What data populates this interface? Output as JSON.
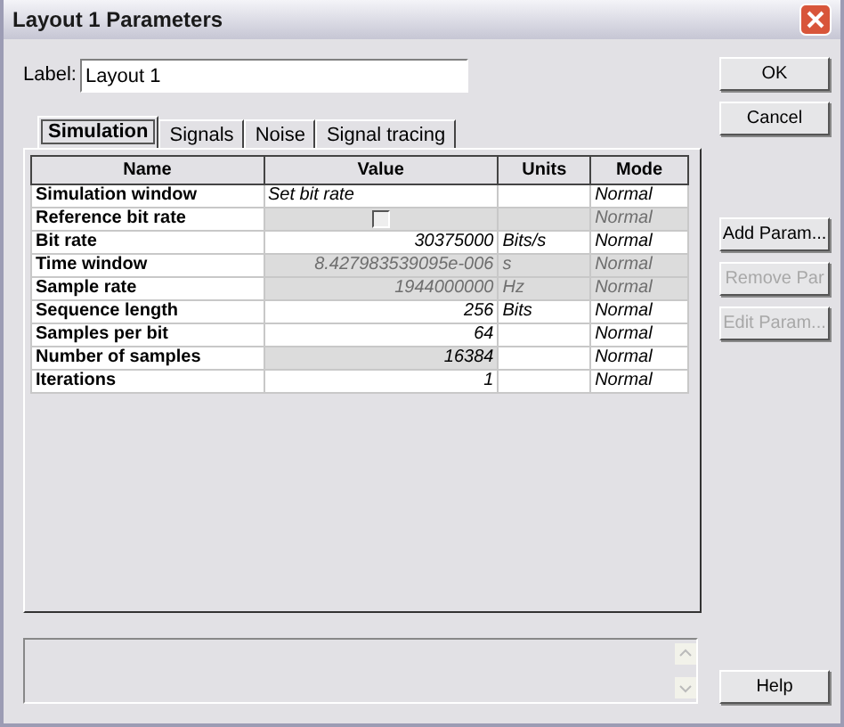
{
  "window": {
    "title": "Layout 1 Parameters"
  },
  "label": {
    "text": "Label:",
    "value": "Layout 1"
  },
  "tabs": [
    {
      "label": "Simulation",
      "selected": true
    },
    {
      "label": "Signals",
      "selected": false
    },
    {
      "label": "Noise",
      "selected": false
    },
    {
      "label": "Signal tracing",
      "selected": false
    }
  ],
  "table": {
    "columns": [
      "Name",
      "Value",
      "Units",
      "Mode"
    ],
    "rows": [
      {
        "name": "Simulation window",
        "kind": "text",
        "value": "Set bit rate",
        "units": "",
        "mode": "Normal",
        "disabled": false,
        "value_shaded": false,
        "units_shaded": false
      },
      {
        "name": "Reference bit rate",
        "kind": "checkbox",
        "checked": false,
        "units": "",
        "mode": "Normal",
        "disabled": true,
        "value_shaded": true,
        "units_shaded": true
      },
      {
        "name": "Bit rate",
        "kind": "number",
        "value": "30375000",
        "units": "Bits/s",
        "mode": "Normal",
        "disabled": false,
        "value_shaded": false,
        "units_shaded": false
      },
      {
        "name": "Time window",
        "kind": "number",
        "value": "8.427983539095e-006",
        "units": "s",
        "mode": "Normal",
        "disabled": true,
        "value_shaded": true,
        "units_shaded": true
      },
      {
        "name": "Sample rate",
        "kind": "number",
        "value": "1944000000",
        "units": "Hz",
        "mode": "Normal",
        "disabled": true,
        "value_shaded": true,
        "units_shaded": true
      },
      {
        "name": "Sequence length",
        "kind": "number",
        "value": "256",
        "units": "Bits",
        "mode": "Normal",
        "disabled": false,
        "value_shaded": false,
        "units_shaded": false
      },
      {
        "name": "Samples per bit",
        "kind": "number",
        "value": "64",
        "units": "",
        "mode": "Normal",
        "disabled": false,
        "value_shaded": false,
        "units_shaded": false
      },
      {
        "name": "Number of samples",
        "kind": "number",
        "value": "16384",
        "units": "",
        "mode": "Normal",
        "disabled": false,
        "value_shaded": true,
        "units_shaded": false
      },
      {
        "name": "Iterations",
        "kind": "number",
        "value": "1",
        "units": "",
        "mode": "Normal",
        "disabled": false,
        "value_shaded": false,
        "units_shaded": false
      }
    ]
  },
  "buttons": [
    {
      "label": "OK",
      "disabled": false
    },
    {
      "label": "Cancel",
      "disabled": false
    },
    {
      "label": "Add Param...",
      "disabled": false
    },
    {
      "label": "Remove Par",
      "disabled": true
    },
    {
      "label": "Edit Param...",
      "disabled": true
    },
    {
      "label": "Help",
      "disabled": false
    }
  ]
}
